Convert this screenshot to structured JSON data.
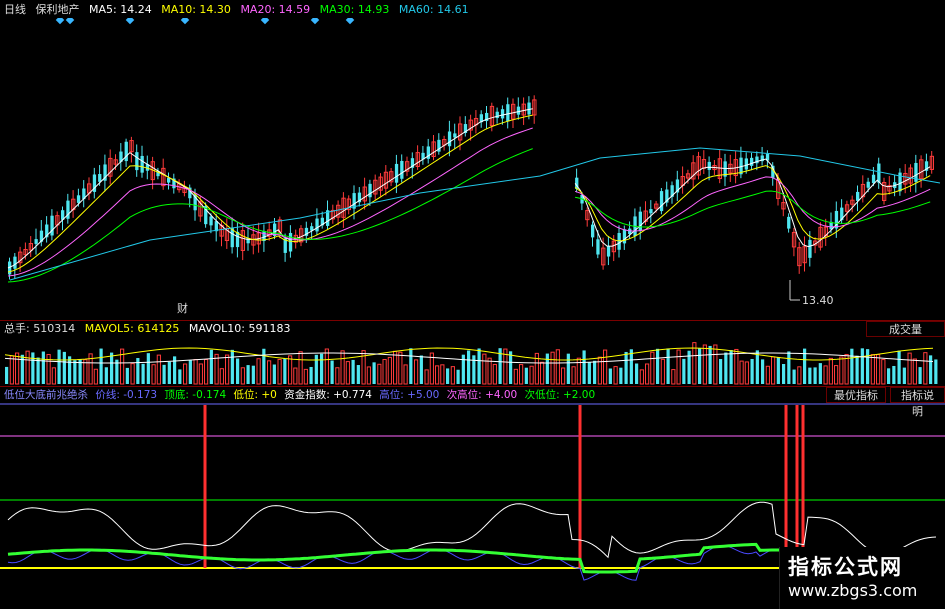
{
  "colors": {
    "up": "#ff3b3b",
    "down": "#4fe6f0",
    "ma5": "#ffffff",
    "ma10": "#ffff00",
    "ma20": "#ff66ff",
    "ma30": "#00ff00",
    "ma60": "#22c8e8",
    "separator": "#7a0000"
  },
  "header": {
    "period": "日线",
    "stock_name": "保利地产",
    "ma5": "MA5: 14.24",
    "ma10": "MA10: 14.30",
    "ma20": "MA20: 14.59",
    "ma30": "MA30: 14.93",
    "ma60": "MA60: 14.61"
  },
  "price_panel": {
    "low_label": "13.40",
    "event_marker": "财"
  },
  "volume_header": {
    "total": "总手: 510314",
    "mavol5": "MAVOL5: 614125",
    "mavol10": "MAVOL10: 591183",
    "button": "成交量"
  },
  "indicator_header": {
    "name": "低位大底前兆绝杀",
    "price_line": "价线: -0.173",
    "bottom": "顶底: -0.174",
    "low_level": "低位: +0",
    "fund_index": "资金指数: +0.774",
    "high_level": "高位: +5.00",
    "sub_high": "次高位: +4.00",
    "sub_low": "次低位: +2.00",
    "button_best": "最优指标",
    "button_help": "指标说明"
  },
  "watermark": {
    "title": "指标公式网",
    "url": "www.zbgs3.com"
  }
}
